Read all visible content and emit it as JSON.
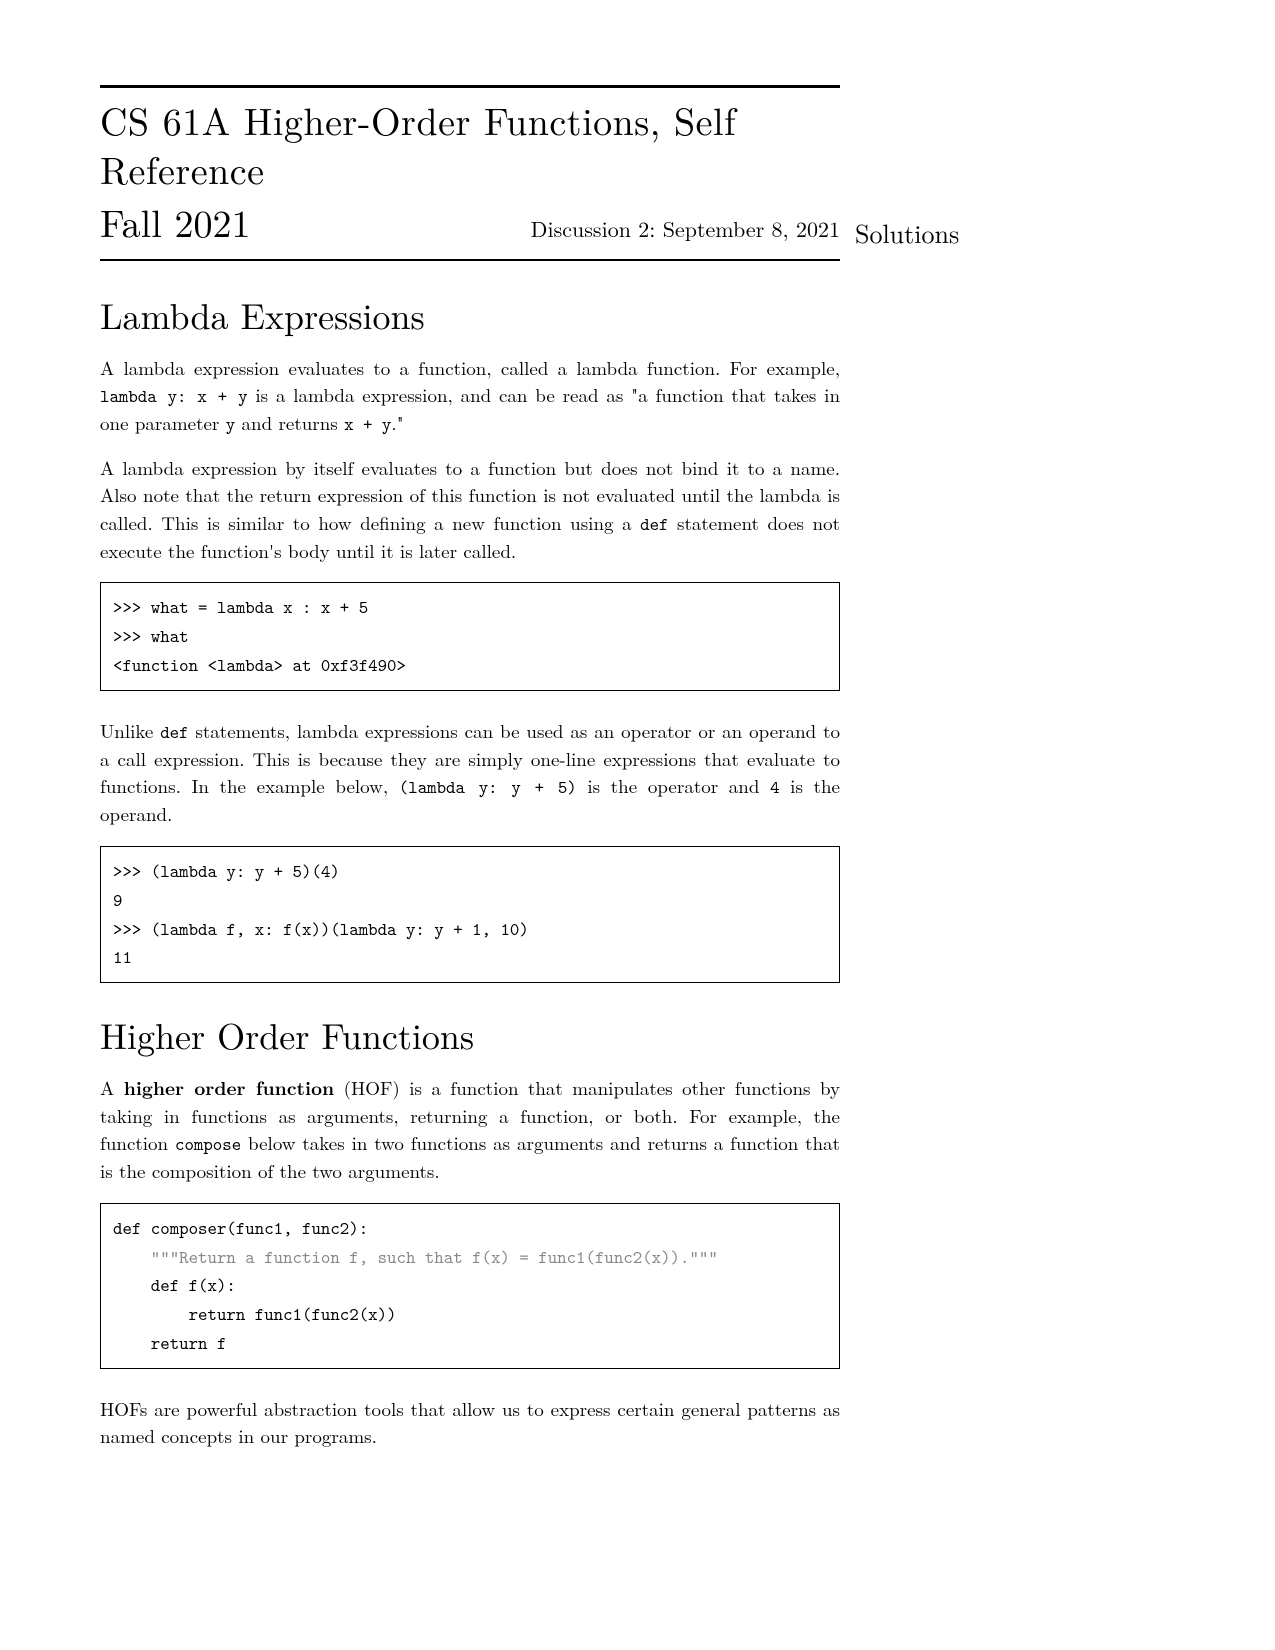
{
  "header": {
    "course_title": "CS 61A  Higher-Order Functions, Self Reference",
    "term": "Fall 2021",
    "discussion": "Discussion 2: September 8, 2021",
    "solutions": "Solutions"
  },
  "section1": {
    "title": "Lambda Expressions",
    "p1_a": "A lambda expression evaluates to a function, called a lambda function. For example, ",
    "p1_code": "lambda y: x + y",
    "p1_b": " is a lambda expression, and can be read as \"a function that takes in one parameter ",
    "p1_code2": "y",
    "p1_c": " and returns ",
    "p1_code3": "x + y",
    "p1_d": ".\"",
    "p2_a": "A lambda expression by itself evaluates to a function but does not bind it to a name. Also note that the return expression of this function is not evaluated until the lambda is called. This is similar to how defining a new function using a ",
    "p2_code": "def",
    "p2_b": " statement does not execute the function's body until it is later called.",
    "code1": ">>> what = lambda x : x + 5\n>>> what\n<function <lambda> at 0xf3f490>",
    "p3_a": "Unlike ",
    "p3_code": "def",
    "p3_b": " statements, lambda expressions can be used as an operator or an operand to a call expression. This is because they are simply one-line expressions that evaluate to functions. In the example below, ",
    "p3_code2": "(lambda y: y + 5)",
    "p3_c": " is the operator and ",
    "p3_code3": "4",
    "p3_d": " is the operand.",
    "code2": ">>> (lambda y: y + 5)(4)\n9\n>>> (lambda f, x: f(x))(lambda y: y + 1, 10)\n11"
  },
  "section2": {
    "title": "Higher Order Functions",
    "p1_a": "A ",
    "p1_bold": "higher order function",
    "p1_b": " (HOF) is a function that manipulates other functions by taking in functions as arguments, returning a function, or both. For example, the function ",
    "p1_code": "compose",
    "p1_c": " below takes in two functions as arguments and returns a function that is the composition of the two arguments.",
    "code1_l1": "def composer(func1, func2):",
    "code1_l2": "    \"\"\"Return a function f, such that f(x) = func1(func2(x)).\"\"\"",
    "code1_l3": "    def f(x):",
    "code1_l4": "        return func1(func2(x))",
    "code1_l5": "    return f",
    "p2": "HOFs are powerful abstraction tools that allow us to express certain general patterns as named concepts in our programs."
  }
}
